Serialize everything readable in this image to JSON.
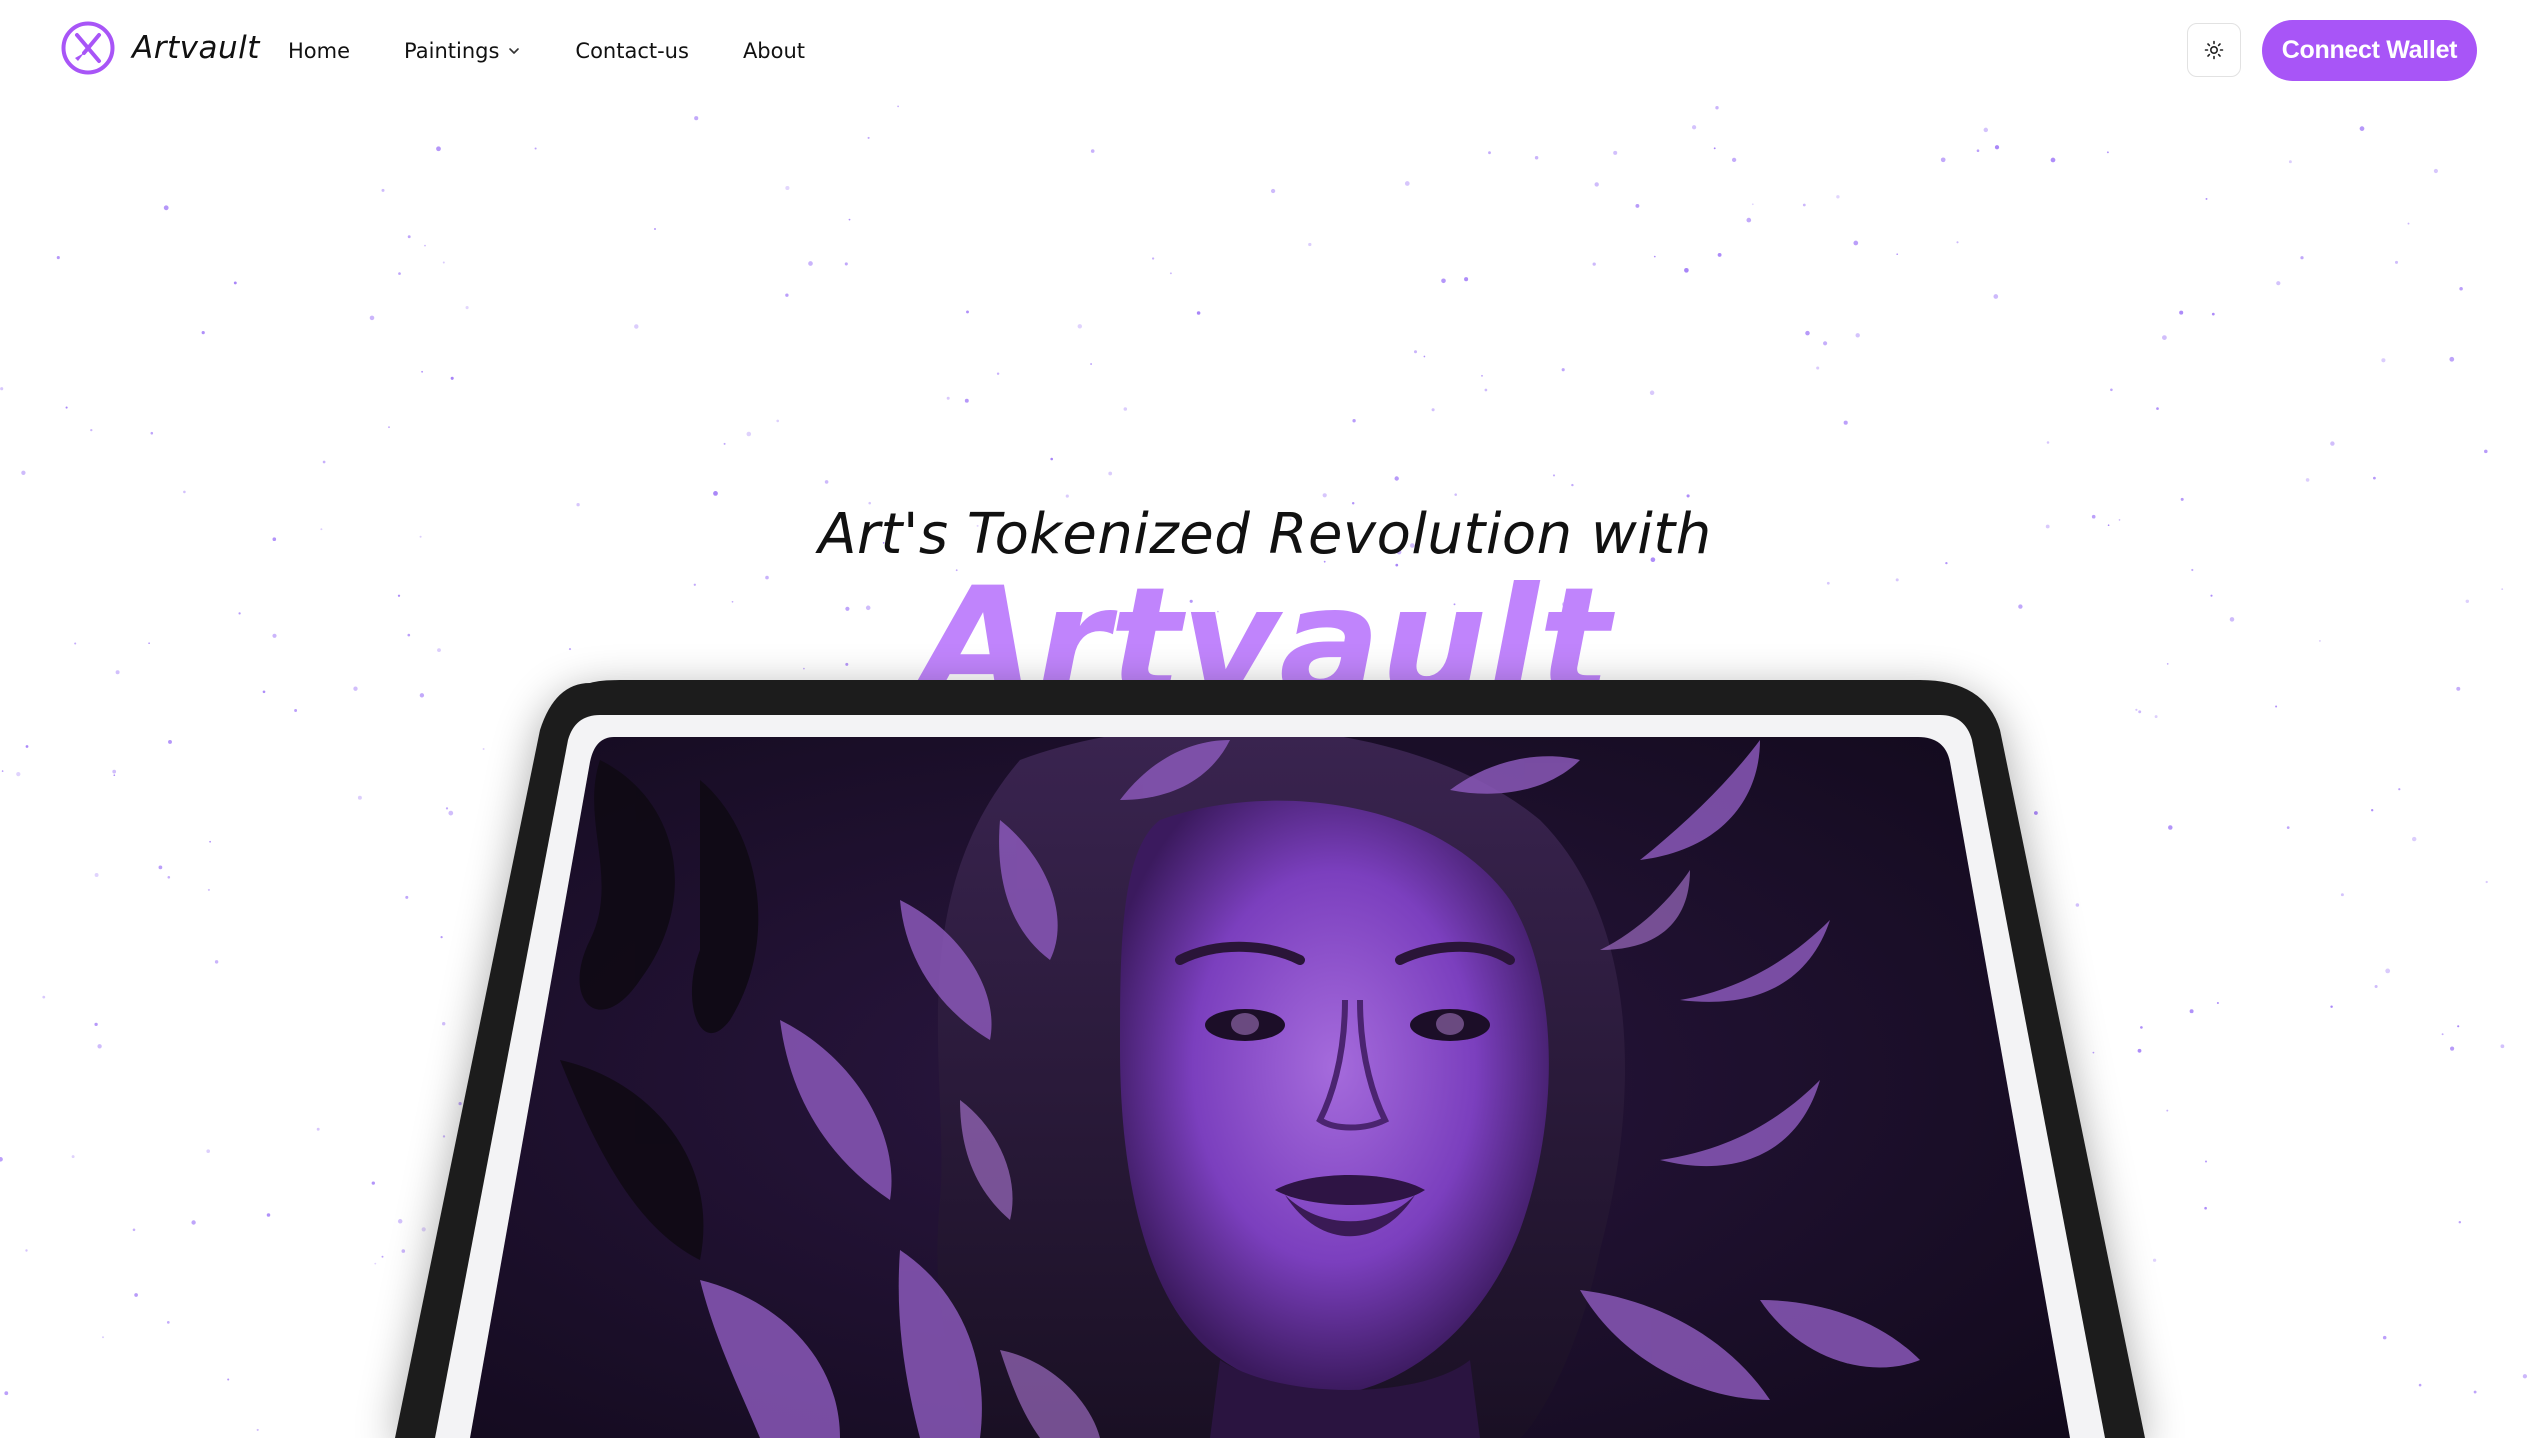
{
  "header": {
    "brand": "Artvault",
    "nav": [
      {
        "label": "Home"
      },
      {
        "label": "Paintings"
      },
      {
        "label": "Contact-us"
      },
      {
        "label": "About"
      }
    ],
    "theme_toggle_icon": "sun-icon",
    "connect_label": "Connect Wallet"
  },
  "hero": {
    "line1": "Art's Tokenized Revolution with",
    "line2": "Artvault",
    "image_icon": "purple-portrait-artwork"
  },
  "colors": {
    "accent": "#a855f7",
    "accent_light": "#c084fc",
    "text": "#111111",
    "background": "#ffffff",
    "tablet_frame": "#1f1f1f",
    "star": "#8b5cf6"
  }
}
